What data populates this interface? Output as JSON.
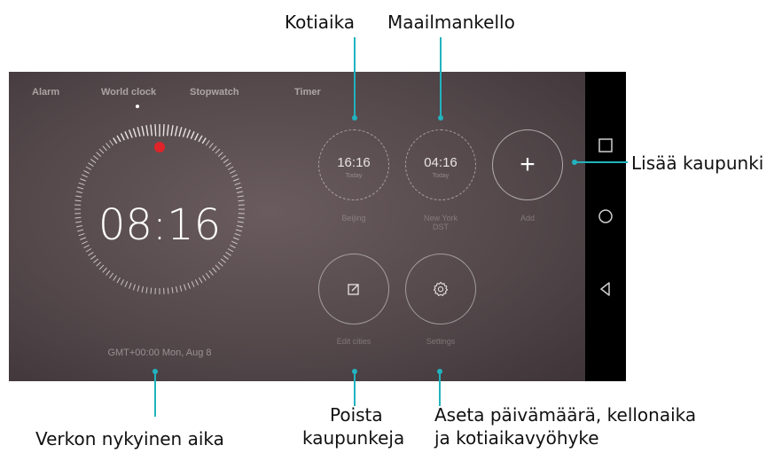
{
  "tabs": [
    {
      "label": "Alarm"
    },
    {
      "label": "World clock"
    },
    {
      "label": "Stopwatch"
    },
    {
      "label": "Timer"
    }
  ],
  "clock": {
    "time": "08:16",
    "footer": "GMT+00:00  Mon, Aug 8"
  },
  "cities": [
    {
      "time": "16:16",
      "sub": "Today",
      "label": "Beijing"
    },
    {
      "time": "04:16",
      "sub": "Today",
      "label": "New York\nDST"
    }
  ],
  "add_label": "Add",
  "edit_label": "Edit cities",
  "settings_label": "Settings",
  "annotations": {
    "home_time": "Kotiaika",
    "world_clock": "Maailmankello",
    "add_city": "Lisää kaupunki",
    "network_time": "Verkon nykyinen aika",
    "remove_cities_1": "Poista",
    "remove_cities_2": "kaupunkeja",
    "set_date_1": "Aseta päivämäärä, kellonaika",
    "set_date_2": "ja kotiaikavyöhyke"
  },
  "colors": {
    "callout": "#21b3be",
    "screen": "#54484b",
    "accent_dot": "#e0242a"
  },
  "icons": [
    "recent-apps-icon",
    "home-icon",
    "back-icon",
    "edit-icon",
    "gear-icon",
    "plus-icon"
  ]
}
